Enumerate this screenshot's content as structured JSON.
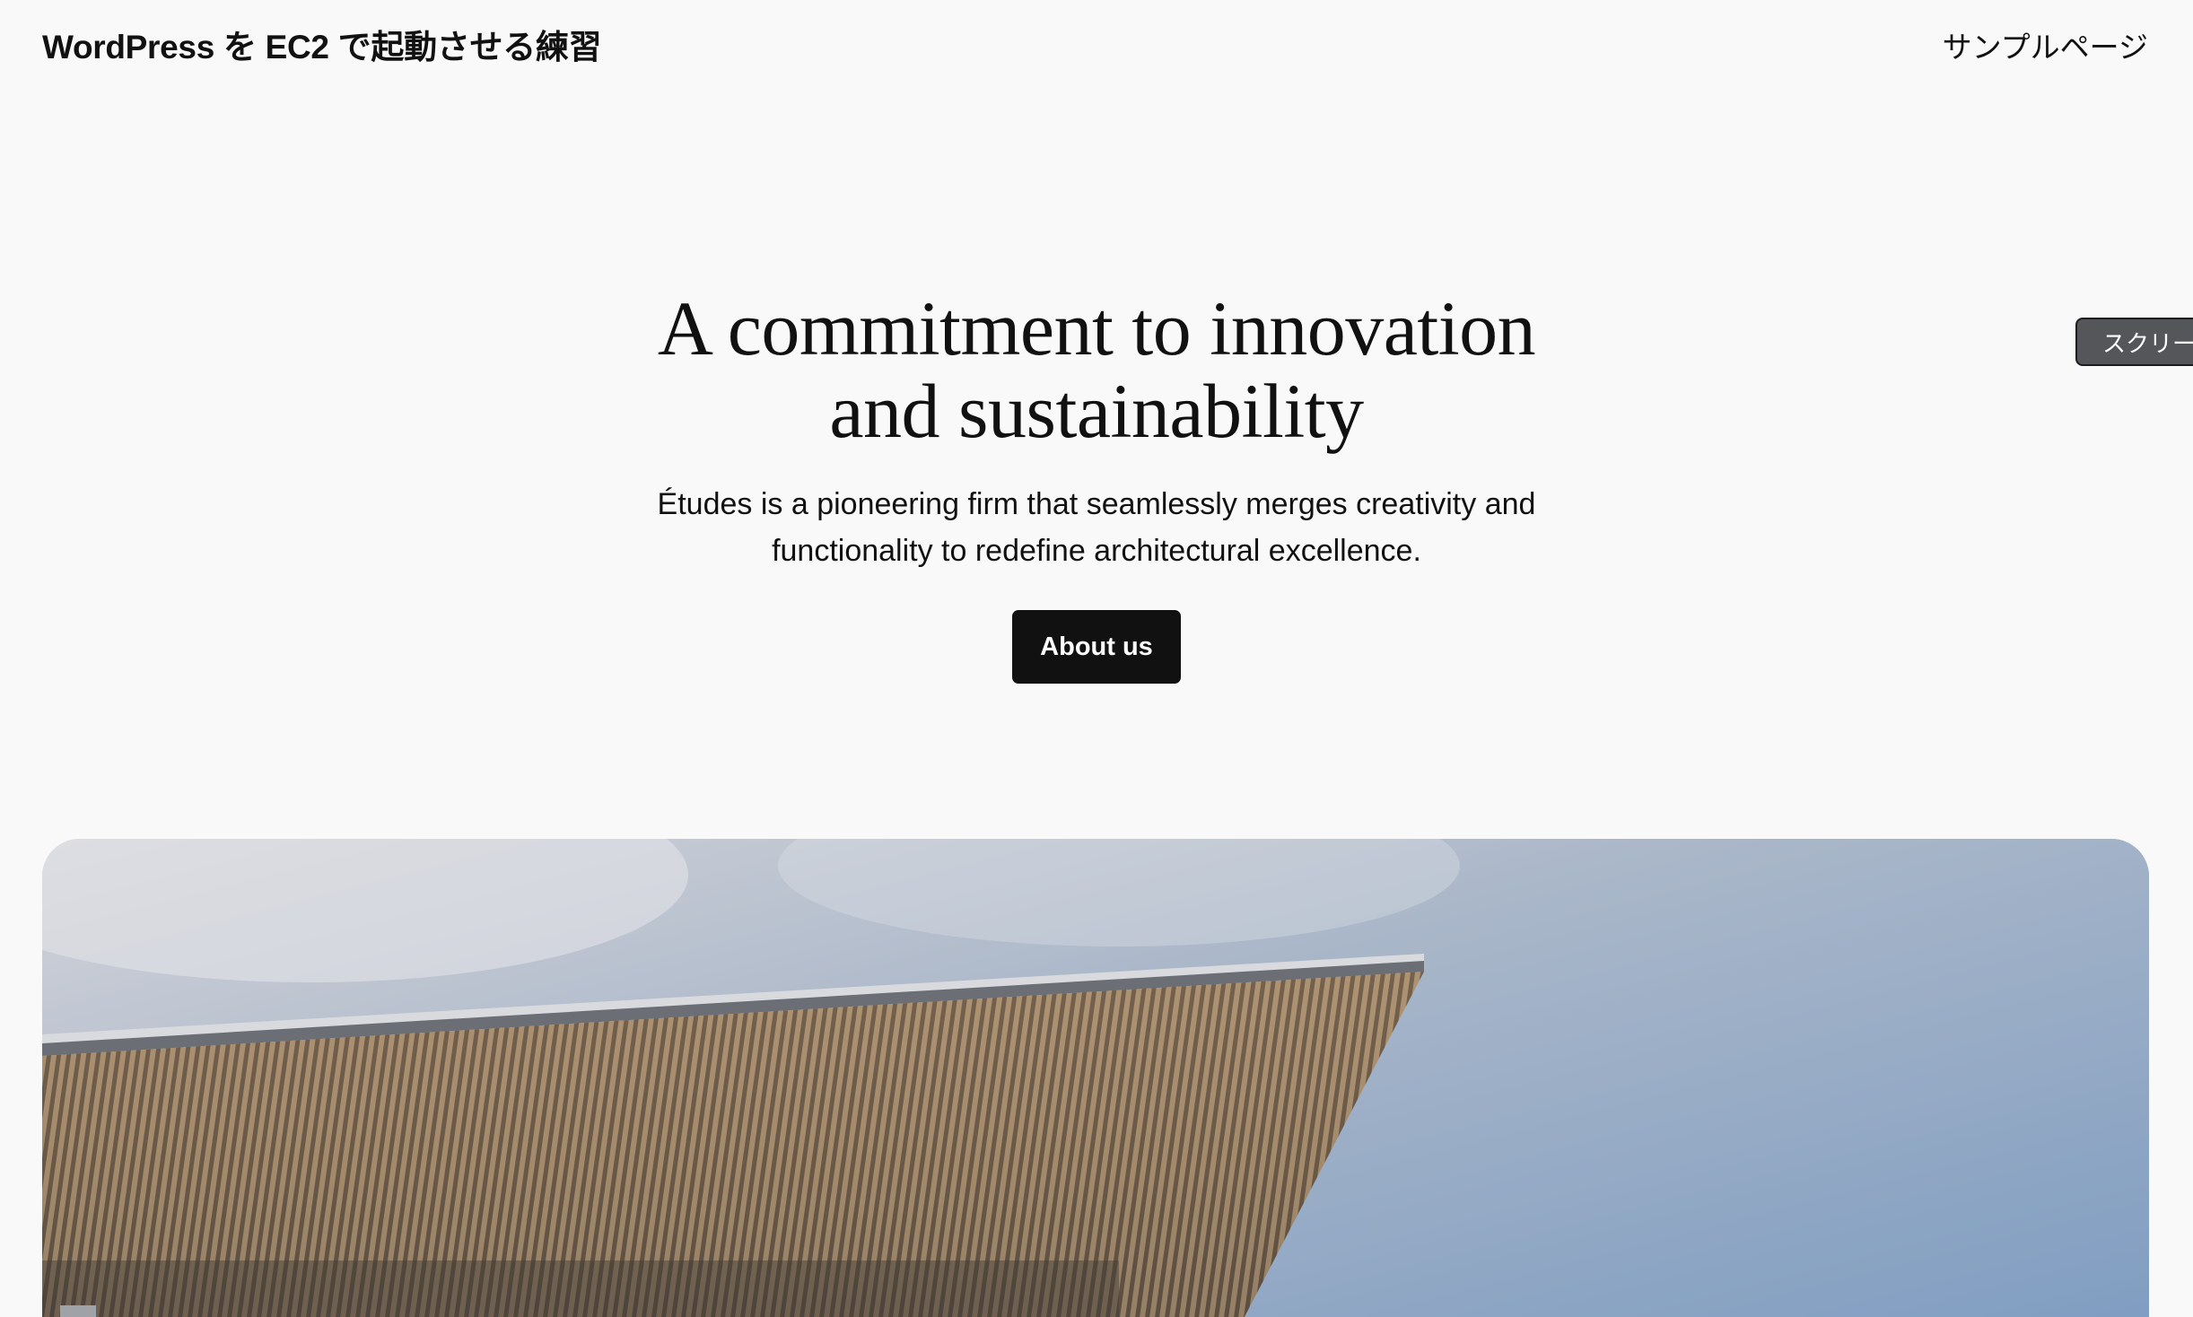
{
  "header": {
    "site_title": "WordPress を EC2 で起動させる練習",
    "nav": [
      {
        "label": "サンプルページ"
      }
    ]
  },
  "hero": {
    "heading_line1": "A commitment to innovation",
    "heading_line2": "and sustainability",
    "text_line1": "Études is a pioneering firm that seamlessly merges creativity and",
    "text_line2": "functionality to redefine architectural excellence.",
    "button_label": "About us"
  },
  "overlay": {
    "screen_options_label": "スクリー"
  },
  "image": {
    "subject": "building-canopy-photo"
  },
  "colors": {
    "background": "#f9f9f9",
    "text": "#111111",
    "button_bg": "#111111",
    "button_text": "#ffffff",
    "sky": "#8fa7c6"
  }
}
